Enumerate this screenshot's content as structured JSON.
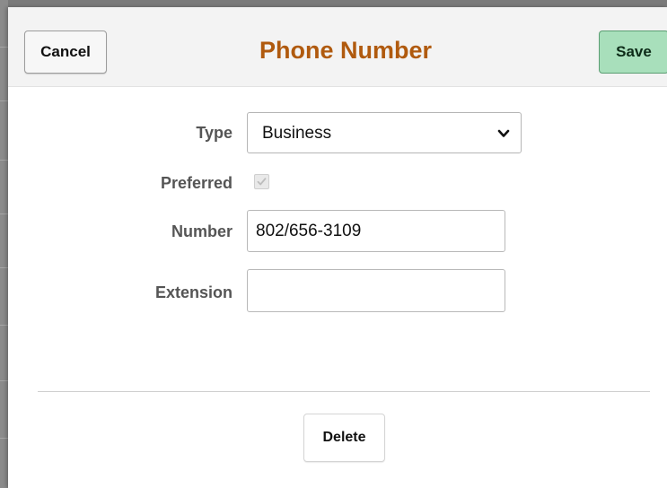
{
  "header": {
    "title": "Phone Number",
    "cancel_label": "Cancel",
    "save_label": "Save"
  },
  "form": {
    "type_label": "Type",
    "type_value": "Business",
    "preferred_label": "Preferred",
    "preferred_checked": true,
    "preferred_disabled": true,
    "number_label": "Number",
    "number_value": "802/656-3109",
    "extension_label": "Extension",
    "extension_value": ""
  },
  "footer": {
    "delete_label": "Delete"
  },
  "icons": {
    "type_dropdown": "chevron-down-icon",
    "preferred_check": "checkmark-icon"
  },
  "colors": {
    "title": "#b05a0e",
    "save_bg": "#a8dfbb",
    "header_bg": "#f3f3f3"
  }
}
